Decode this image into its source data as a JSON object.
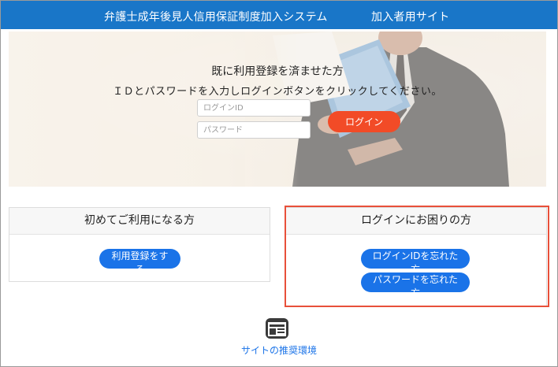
{
  "header": {
    "title": "弁護士成年後見人信用保証制度加入システム",
    "subtitle": "加入者用サイト"
  },
  "login": {
    "heading": "既に利用登録を済ませた方",
    "description": "ＩＤとパスワードを入力しログインボタンをクリックしてください。",
    "id_placeholder": "ログインID",
    "password_placeholder": "パスワード",
    "login_label": "ログイン"
  },
  "new_user": {
    "heading": "初めてご利用になる方",
    "register_label": "利用登録をする"
  },
  "help": {
    "heading": "ログインにお困りの方",
    "forgot_id_label": "ログインIDを忘れた方",
    "forgot_password_label": "パスワードを忘れた方"
  },
  "footer": {
    "environment_link": "サイトの推奨環境",
    "environment_icon": "browser-window-icon"
  },
  "colors": {
    "header_bg": "#1976c8",
    "login_button": "#f24b27",
    "primary_button": "#1a73e8",
    "highlight_border": "#e8503a"
  }
}
